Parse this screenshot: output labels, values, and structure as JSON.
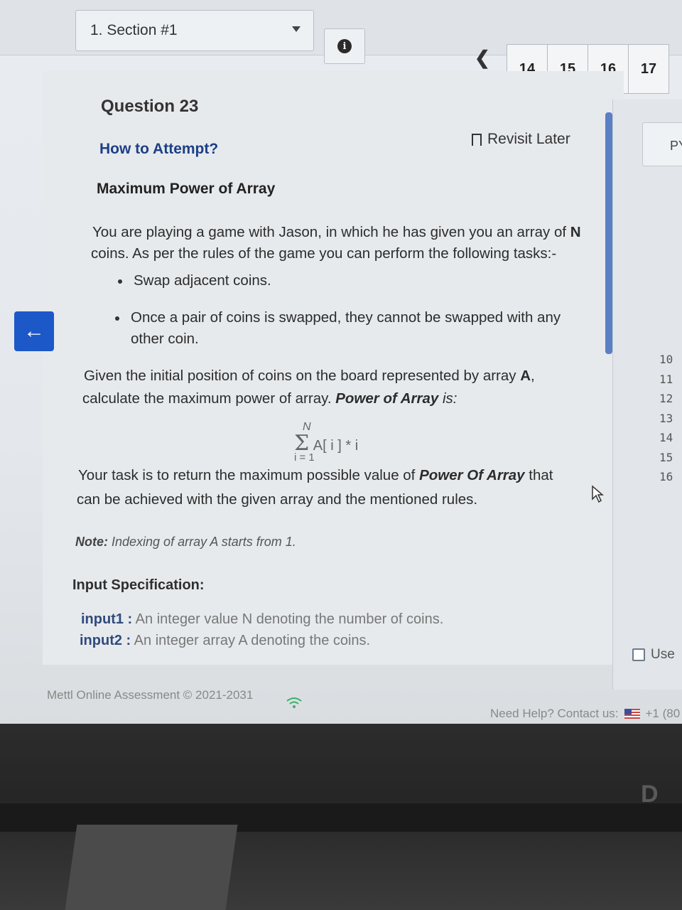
{
  "header": {
    "section_select": "1. Section #1",
    "info_icon_glyph": "i",
    "prev_icon": "chevron-left-icon",
    "question_numbers": [
      "14",
      "15",
      "16",
      "17"
    ]
  },
  "question": {
    "title": "Question 23",
    "revisit_label": "Revisit Later",
    "how_to": "How to Attempt?",
    "problem_title": "Maximum Power of Array",
    "intro_1_a": "You are playing a game with Jason, in which he has given you an array of ",
    "intro_1_b": "N",
    "intro_2": "coins. As per the rules of the game you can perform the following tasks:-",
    "bullet_1": "Swap adjacent coins.",
    "bullet_2_line1": "Once a pair of coins is swapped, they cannot be swapped with any",
    "bullet_2_line2": "other coin.",
    "given_1_a": "Given the initial position of coins on the board represented by array ",
    "given_1_b": "A",
    "given_1_c": ",",
    "given_2_a": "calculate the maximum power of array. ",
    "given_2_b": "Power of Array",
    "given_2_c": " is:",
    "formula_top": "N",
    "formula_sum": "Σ",
    "formula_body": "A[ i ] * i",
    "formula_bottom": "i = 1",
    "task_1_a": "Your task is to return the maximum possible value of ",
    "task_1_b": "Power Of Array",
    "task_1_c": " that",
    "task_2": "can be achieved with the given array and the mentioned rules.",
    "note_label": "Note:",
    "note_text": " Indexing of array A starts from 1.",
    "input_spec": "Input Specification:",
    "input1_label": "input1 :",
    "input1_text": " An integer value N denoting the number of coins.",
    "input2_label": "input2 :",
    "input2_text": " An integer array A  denoting the coins."
  },
  "right_panel": {
    "lang_box": "PY",
    "line_numbers": [
      "10",
      "11",
      "12",
      "13",
      "14",
      "15",
      "16"
    ],
    "use_label": "Use"
  },
  "footer": {
    "copyright": "Mettl Online Assessment © 2021-2031",
    "help": "Need Help? Contact us:",
    "phone": "+1 (80"
  },
  "colors": {
    "accent": "#1c58c8",
    "link": "#1c3f86"
  }
}
